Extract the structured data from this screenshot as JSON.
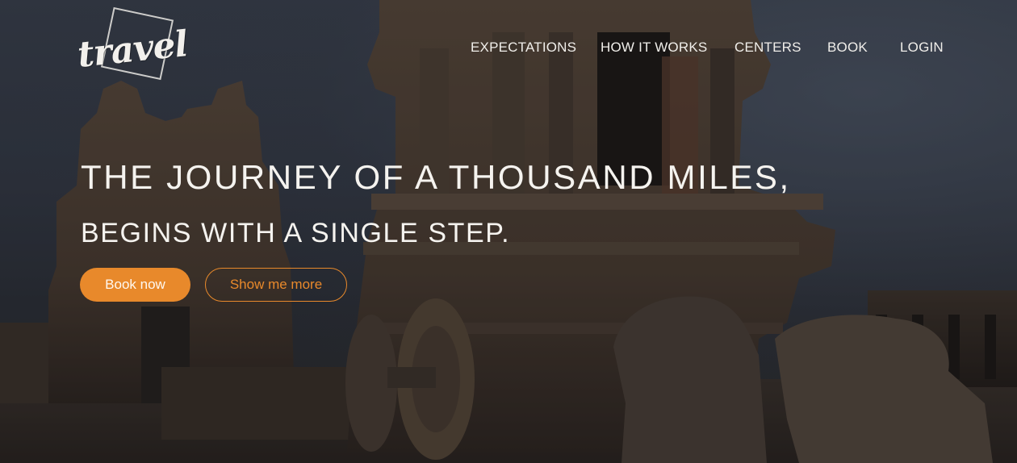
{
  "logo": {
    "text": "travel"
  },
  "nav": {
    "items": [
      {
        "label": "EXPECTATIONS"
      },
      {
        "label": "HOW IT WORKS"
      },
      {
        "label": "CENTERS"
      },
      {
        "label": "BOOK"
      },
      {
        "label": "LOGIN"
      }
    ]
  },
  "hero": {
    "headline": "THE JOURNEY OF A THOUSAND MILES,",
    "subheadline": "BEGINS WITH A SINGLE STEP.",
    "primary_button": "Book now",
    "secondary_button": "Show me more"
  },
  "colors": {
    "accent": "#e8892b",
    "text": "#f5f3ef"
  }
}
